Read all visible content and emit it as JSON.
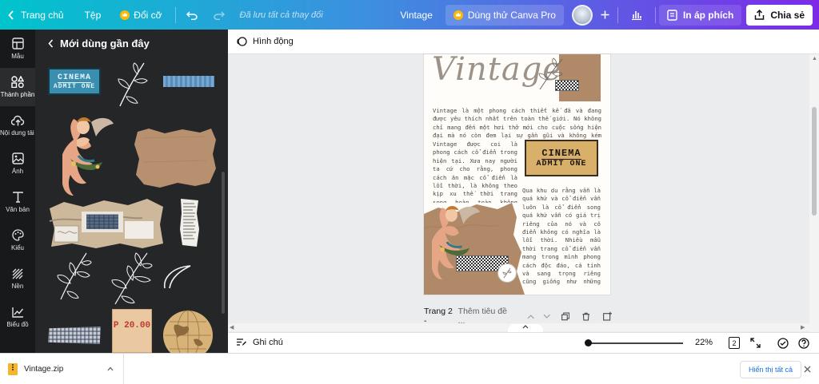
{
  "topbar": {
    "home_label": "Trang chủ",
    "file_label": "Tệp",
    "resize_label": "Đổi cỡ",
    "save_status": "Đã lưu tất cả thay đổi",
    "doc_title": "Vintage",
    "try_pro_label": "Dùng thử Canva Pro",
    "print_label": "In áp phích",
    "share_label": "Chia sẻ"
  },
  "rail": {
    "items": [
      {
        "label": "Mẫu",
        "icon": "template-icon"
      },
      {
        "label": "Thành phần",
        "icon": "elements-icon"
      },
      {
        "label": "Nội dung tải lên",
        "icon": "upload-icon"
      },
      {
        "label": "Ảnh",
        "icon": "photo-icon"
      },
      {
        "label": "Văn bản",
        "icon": "text-icon"
      },
      {
        "label": "Kiểu",
        "icon": "palette-icon"
      },
      {
        "label": "Nền",
        "icon": "background-icon"
      },
      {
        "label": "Biểu đồ",
        "icon": "chart-icon"
      }
    ]
  },
  "panel": {
    "title": "Mới dùng gần đây",
    "ticket": {
      "line1": "CINEMA",
      "line2": "ADMIT ONE"
    },
    "price_tag": "P 20.00"
  },
  "editor": {
    "animate_label": "Hình động",
    "page": {
      "title": "Vintage",
      "para1": "Vintage là một phong cách thiết kế đã và đang được yêu thích nhất trên toàn thế giới. Nó không chỉ mang đến một hơi thở mới cho cuộc sống hiện đại mà nó còn đem lại sự gần gũi và không kém phần sang trọng.",
      "para2": "Vintage được coi là phong cách cổ điển trong hiện tại. Xưa nay người ta cứ cho rằng, phong cách ăn mặc cổ điển là lỗi thời, là không theo kịp xu thế thời trang song hoàn toàn không phải vậy.",
      "para3": "Qua khu du rằng vẫn là quá khứ và cổ điển vẫn luôn là cổ điển song quá khứ vẫn có giá trị riêng của nó và cổ điển không có nghĩa là lỗi thời. Nhiều mẫu thời trang cổ điển vẫn mang trong mình phong cách độc đáo, cá tính và sang trọng riêng cũng giống như những ngôi nhà cổ điển ngày càng trở nên quý hiếm và có giá trị.",
      "ticket": {
        "line1": "CINEMA",
        "line2": "ADMIT ONE"
      }
    },
    "page_label": "Trang 2 -",
    "page_title_placeholder": "Thêm tiêu đề ...",
    "notes_label": "Ghi chú",
    "zoom": "22%",
    "zoom_fraction": 0.03,
    "page_count": "2"
  },
  "downloads": {
    "file_name": "Vintage.zip",
    "show_all": "Hiển thị tất cả"
  }
}
